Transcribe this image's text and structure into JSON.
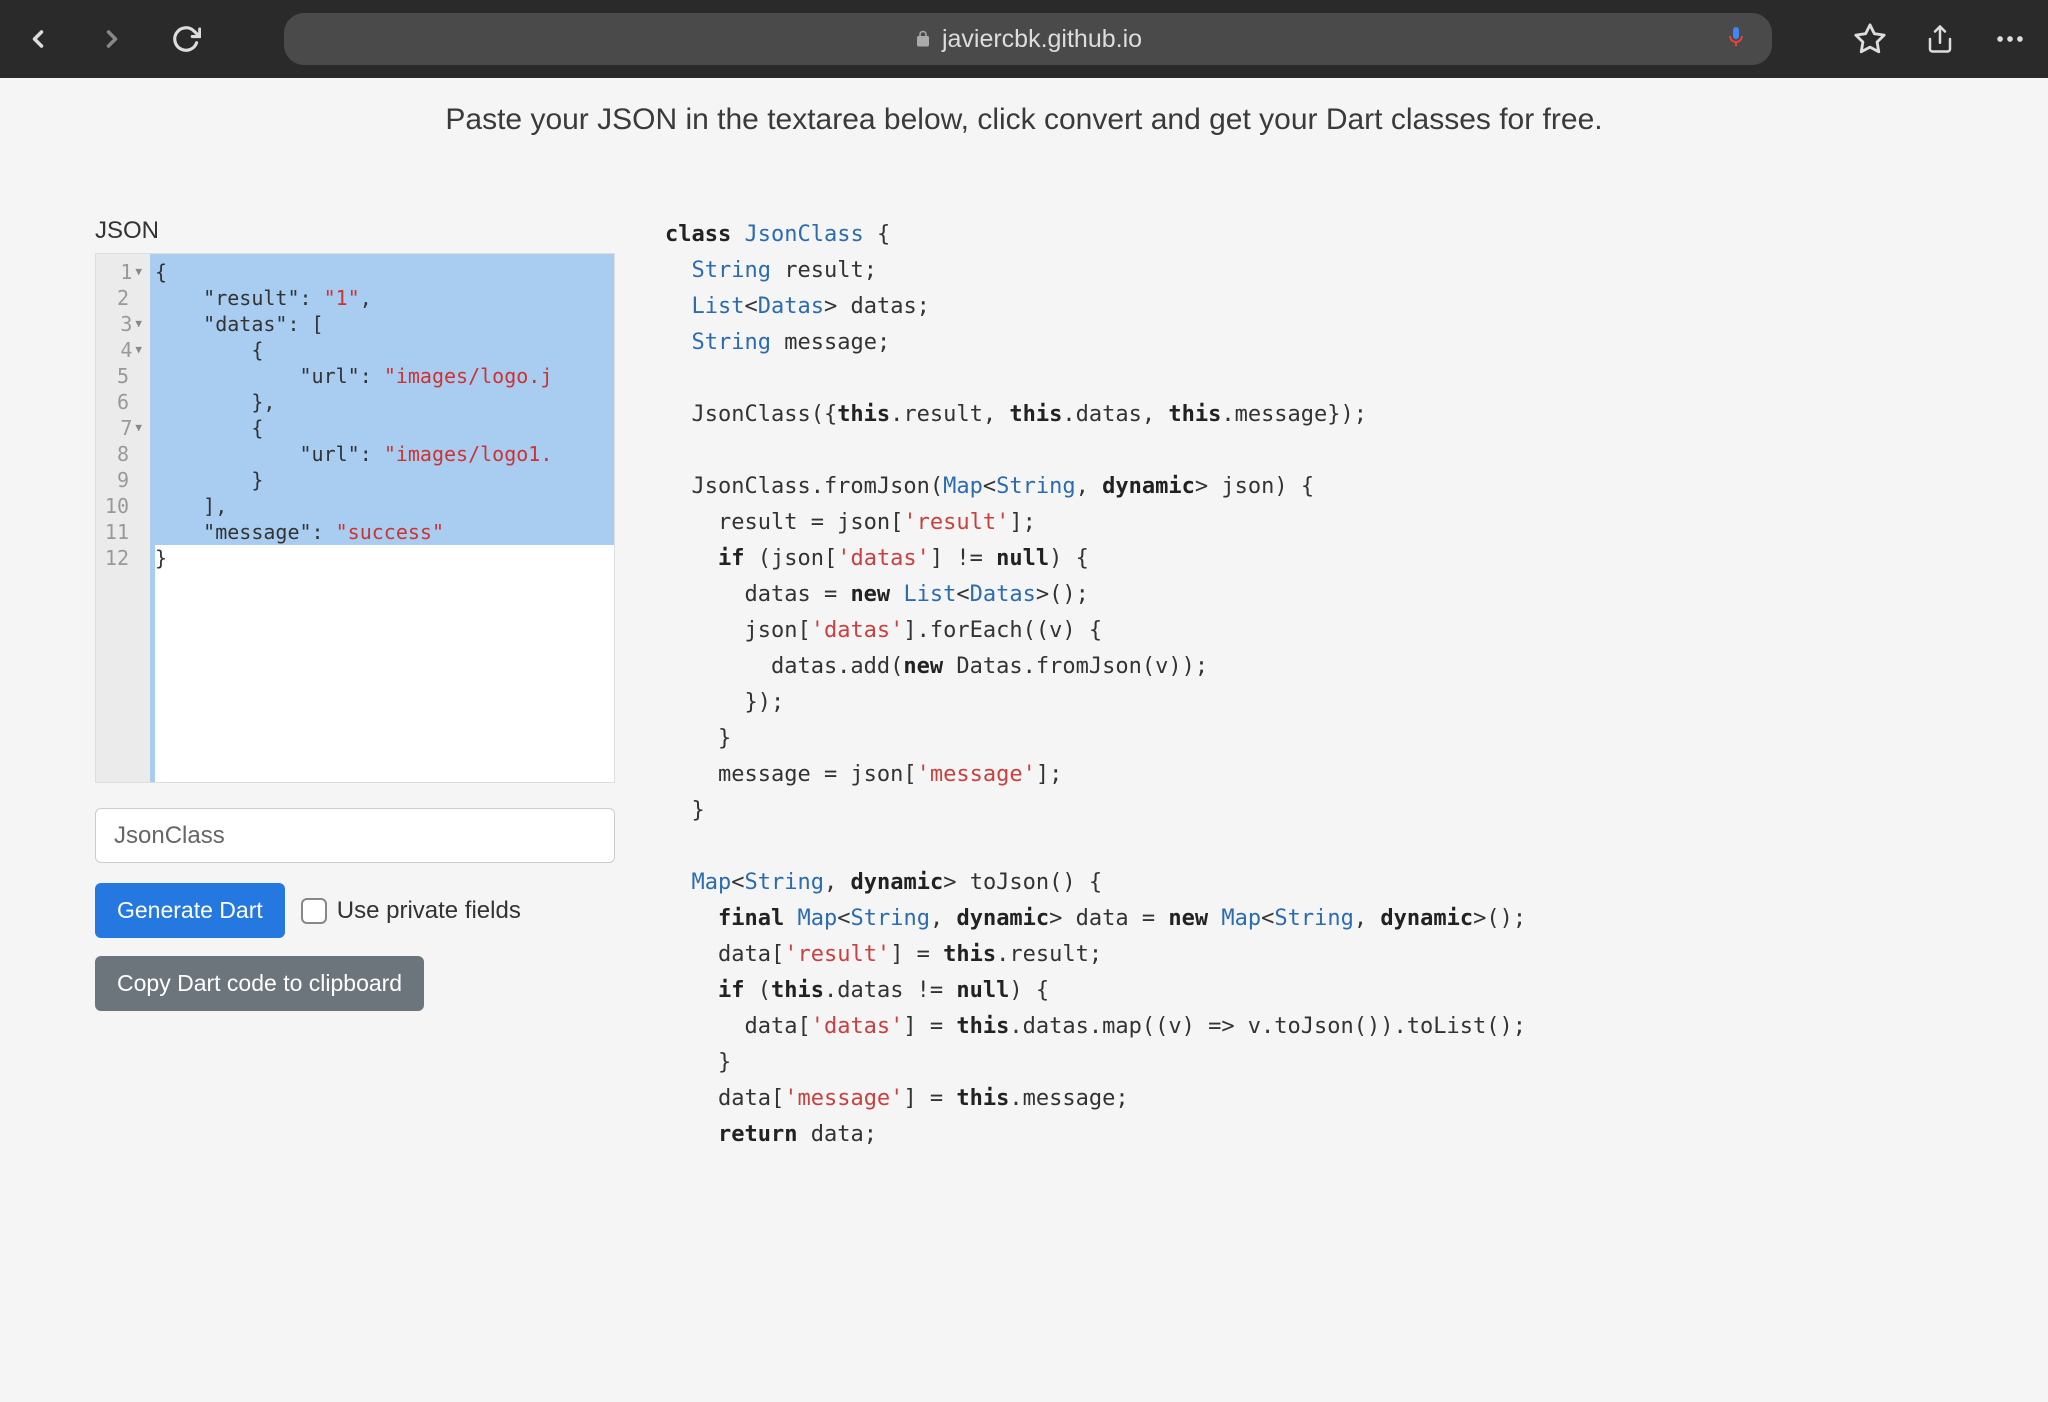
{
  "browser": {
    "url": "javiercbk.github.io"
  },
  "page": {
    "headline": "Paste your JSON in the textarea below, click convert and get your Dart classes for free."
  },
  "left": {
    "section_label": "JSON",
    "line_numbers": [
      "1",
      "2",
      "3",
      "4",
      "5",
      "6",
      "7",
      "8",
      "9",
      "10",
      "11",
      "12"
    ],
    "fold_lines": [
      0,
      2,
      3,
      6
    ],
    "json_lines": [
      [
        {
          "c": "tok-brace",
          "t": "{"
        }
      ],
      [
        {
          "c": "",
          "t": "    "
        },
        {
          "c": "tok-key",
          "t": "\"result\""
        },
        {
          "c": "tok-punct",
          "t": ": "
        },
        {
          "c": "tok-str",
          "t": "\"1\""
        },
        {
          "c": "tok-punct",
          "t": ","
        }
      ],
      [
        {
          "c": "",
          "t": "    "
        },
        {
          "c": "tok-key",
          "t": "\"datas\""
        },
        {
          "c": "tok-punct",
          "t": ": ["
        }
      ],
      [
        {
          "c": "",
          "t": "        "
        },
        {
          "c": "tok-brace",
          "t": "{"
        }
      ],
      [
        {
          "c": "",
          "t": "            "
        },
        {
          "c": "tok-key",
          "t": "\"url\""
        },
        {
          "c": "tok-punct",
          "t": ": "
        },
        {
          "c": "tok-str",
          "t": "\"images/logo.j"
        }
      ],
      [
        {
          "c": "",
          "t": "        "
        },
        {
          "c": "tok-brace",
          "t": "}"
        },
        {
          "c": "tok-punct",
          "t": ","
        }
      ],
      [
        {
          "c": "",
          "t": "        "
        },
        {
          "c": "tok-brace",
          "t": "{"
        }
      ],
      [
        {
          "c": "",
          "t": "            "
        },
        {
          "c": "tok-key",
          "t": "\"url\""
        },
        {
          "c": "tok-punct",
          "t": ": "
        },
        {
          "c": "tok-str",
          "t": "\"images/logo1."
        }
      ],
      [
        {
          "c": "",
          "t": "        "
        },
        {
          "c": "tok-brace",
          "t": "}"
        }
      ],
      [
        {
          "c": "",
          "t": "    "
        },
        {
          "c": "tok-punct",
          "t": "],"
        }
      ],
      [
        {
          "c": "",
          "t": "    "
        },
        {
          "c": "tok-key",
          "t": "\"message\""
        },
        {
          "c": "tok-punct",
          "t": ": "
        },
        {
          "c": "tok-str",
          "t": "\"success\""
        }
      ],
      [
        {
          "c": "tok-brace",
          "t": "}"
        }
      ]
    ],
    "class_name_value": "JsonClass",
    "generate_label": "Generate Dart",
    "private_fields_label": "Use private fields",
    "copy_label": "Copy Dart code to clipboard"
  },
  "right": {
    "dart_lines": [
      [
        {
          "c": "kw",
          "t": "class"
        },
        {
          "c": "",
          "t": " "
        },
        {
          "c": "type",
          "t": "JsonClass"
        },
        {
          "c": "",
          "t": " {"
        }
      ],
      [
        {
          "c": "",
          "t": "  "
        },
        {
          "c": "type",
          "t": "String"
        },
        {
          "c": "",
          "t": " result;"
        }
      ],
      [
        {
          "c": "",
          "t": "  "
        },
        {
          "c": "type",
          "t": "List"
        },
        {
          "c": "",
          "t": "<"
        },
        {
          "c": "type",
          "t": "Datas"
        },
        {
          "c": "",
          "t": "> datas;"
        }
      ],
      [
        {
          "c": "",
          "t": "  "
        },
        {
          "c": "type",
          "t": "String"
        },
        {
          "c": "",
          "t": " message;"
        }
      ],
      [
        {
          "c": "",
          "t": ""
        }
      ],
      [
        {
          "c": "",
          "t": "  JsonClass({"
        },
        {
          "c": "kw",
          "t": "this"
        },
        {
          "c": "",
          "t": ".result, "
        },
        {
          "c": "kw",
          "t": "this"
        },
        {
          "c": "",
          "t": ".datas, "
        },
        {
          "c": "kw",
          "t": "this"
        },
        {
          "c": "",
          "t": ".message});"
        }
      ],
      [
        {
          "c": "",
          "t": ""
        }
      ],
      [
        {
          "c": "",
          "t": "  JsonClass.fromJson("
        },
        {
          "c": "type",
          "t": "Map"
        },
        {
          "c": "",
          "t": "<"
        },
        {
          "c": "type",
          "t": "String"
        },
        {
          "c": "",
          "t": ", "
        },
        {
          "c": "kw",
          "t": "dynamic"
        },
        {
          "c": "",
          "t": "> json) {"
        }
      ],
      [
        {
          "c": "",
          "t": "    result = json["
        },
        {
          "c": "str",
          "t": "'result'"
        },
        {
          "c": "",
          "t": "];"
        }
      ],
      [
        {
          "c": "",
          "t": "    "
        },
        {
          "c": "kw",
          "t": "if"
        },
        {
          "c": "",
          "t": " (json["
        },
        {
          "c": "str",
          "t": "'datas'"
        },
        {
          "c": "",
          "t": "] != "
        },
        {
          "c": "kw",
          "t": "null"
        },
        {
          "c": "",
          "t": ") {"
        }
      ],
      [
        {
          "c": "",
          "t": "      datas = "
        },
        {
          "c": "kw",
          "t": "new"
        },
        {
          "c": "",
          "t": " "
        },
        {
          "c": "type",
          "t": "List"
        },
        {
          "c": "",
          "t": "<"
        },
        {
          "c": "type",
          "t": "Datas"
        },
        {
          "c": "",
          "t": ">();"
        }
      ],
      [
        {
          "c": "",
          "t": "      json["
        },
        {
          "c": "str",
          "t": "'datas'"
        },
        {
          "c": "",
          "t": "].forEach((v) {"
        }
      ],
      [
        {
          "c": "",
          "t": "        datas.add("
        },
        {
          "c": "kw",
          "t": "new"
        },
        {
          "c": "",
          "t": " Datas.fromJson(v));"
        }
      ],
      [
        {
          "c": "",
          "t": "      });"
        }
      ],
      [
        {
          "c": "",
          "t": "    }"
        }
      ],
      [
        {
          "c": "",
          "t": "    message = json["
        },
        {
          "c": "str",
          "t": "'message'"
        },
        {
          "c": "",
          "t": "];"
        }
      ],
      [
        {
          "c": "",
          "t": "  }"
        }
      ],
      [
        {
          "c": "",
          "t": ""
        }
      ],
      [
        {
          "c": "",
          "t": "  "
        },
        {
          "c": "type",
          "t": "Map"
        },
        {
          "c": "",
          "t": "<"
        },
        {
          "c": "type",
          "t": "String"
        },
        {
          "c": "",
          "t": ", "
        },
        {
          "c": "kw",
          "t": "dynamic"
        },
        {
          "c": "",
          "t": "> toJson() {"
        }
      ],
      [
        {
          "c": "",
          "t": "    "
        },
        {
          "c": "kw",
          "t": "final"
        },
        {
          "c": "",
          "t": " "
        },
        {
          "c": "type",
          "t": "Map"
        },
        {
          "c": "",
          "t": "<"
        },
        {
          "c": "type",
          "t": "String"
        },
        {
          "c": "",
          "t": ", "
        },
        {
          "c": "kw",
          "t": "dynamic"
        },
        {
          "c": "",
          "t": "> data = "
        },
        {
          "c": "kw",
          "t": "new"
        },
        {
          "c": "",
          "t": " "
        },
        {
          "c": "type",
          "t": "Map"
        },
        {
          "c": "",
          "t": "<"
        },
        {
          "c": "type",
          "t": "String"
        },
        {
          "c": "",
          "t": ", "
        },
        {
          "c": "kw",
          "t": "dynamic"
        },
        {
          "c": "",
          "t": ">();"
        }
      ],
      [
        {
          "c": "",
          "t": "    data["
        },
        {
          "c": "str",
          "t": "'result'"
        },
        {
          "c": "",
          "t": "] = "
        },
        {
          "c": "kw",
          "t": "this"
        },
        {
          "c": "",
          "t": ".result;"
        }
      ],
      [
        {
          "c": "",
          "t": "    "
        },
        {
          "c": "kw",
          "t": "if"
        },
        {
          "c": "",
          "t": " ("
        },
        {
          "c": "kw",
          "t": "this"
        },
        {
          "c": "",
          "t": ".datas != "
        },
        {
          "c": "kw",
          "t": "null"
        },
        {
          "c": "",
          "t": ") {"
        }
      ],
      [
        {
          "c": "",
          "t": "      data["
        },
        {
          "c": "str",
          "t": "'datas'"
        },
        {
          "c": "",
          "t": "] = "
        },
        {
          "c": "kw",
          "t": "this"
        },
        {
          "c": "",
          "t": ".datas.map((v) => v.toJson()).toList();"
        }
      ],
      [
        {
          "c": "",
          "t": "    }"
        }
      ],
      [
        {
          "c": "",
          "t": "    data["
        },
        {
          "c": "str",
          "t": "'message'"
        },
        {
          "c": "",
          "t": "] = "
        },
        {
          "c": "kw",
          "t": "this"
        },
        {
          "c": "",
          "t": ".message;"
        }
      ],
      [
        {
          "c": "",
          "t": "    "
        },
        {
          "c": "kw",
          "t": "return"
        },
        {
          "c": "",
          "t": " data;"
        }
      ]
    ]
  }
}
